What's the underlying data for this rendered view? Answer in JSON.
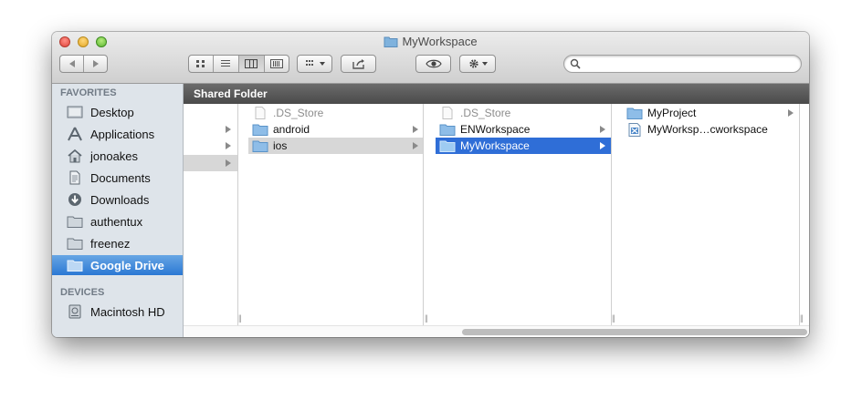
{
  "window": {
    "title": "MyWorkspace"
  },
  "toolbar": {
    "view_icon": "icon-view-button",
    "list_icon": "list-view-button",
    "column_icon": "column-view-button",
    "coverflow_icon": "cover-flow-button",
    "search_placeholder": ""
  },
  "sidebar": {
    "favorites_header": "FAVORITES",
    "favorites": [
      {
        "label": "Desktop",
        "icon": "desktop-icon"
      },
      {
        "label": "Applications",
        "icon": "applications-icon"
      },
      {
        "label": "jonoakes",
        "icon": "home-icon"
      },
      {
        "label": "Documents",
        "icon": "documents-icon"
      },
      {
        "label": "Downloads",
        "icon": "downloads-icon"
      },
      {
        "label": "authentux",
        "icon": "folder-icon"
      },
      {
        "label": "freenez",
        "icon": "folder-icon"
      },
      {
        "label": "Google Drive",
        "icon": "folder-icon",
        "selected": true
      }
    ],
    "devices_header": "DEVICES",
    "devices": [
      {
        "label": "Macintosh HD",
        "icon": "hard-drive-icon"
      }
    ]
  },
  "path_bar": {
    "title": "Shared Folder"
  },
  "columns": [
    {
      "items": []
    },
    {
      "items": [
        {
          "label": ".DS_Store",
          "type": "file",
          "dim": true
        },
        {
          "label": "android",
          "type": "folder"
        },
        {
          "label": "ios",
          "type": "folder",
          "state": "highlighted"
        }
      ]
    },
    {
      "items": [
        {
          "label": ".DS_Store",
          "type": "file",
          "dim": true
        },
        {
          "label": "ENWorkspace",
          "type": "folder"
        },
        {
          "label": "MyWorkspace",
          "type": "folder",
          "state": "selected"
        }
      ]
    },
    {
      "items": [
        {
          "label": "MyProject",
          "type": "folder"
        },
        {
          "label": "MyWorksp…cworkspace",
          "type": "workspace-file"
        }
      ]
    }
  ],
  "colors": {
    "selection": "#2f6ed7",
    "sidebar_selection": "#3d88da",
    "sidebar_bg": "#dee4ea",
    "path_bar": "#555555"
  }
}
